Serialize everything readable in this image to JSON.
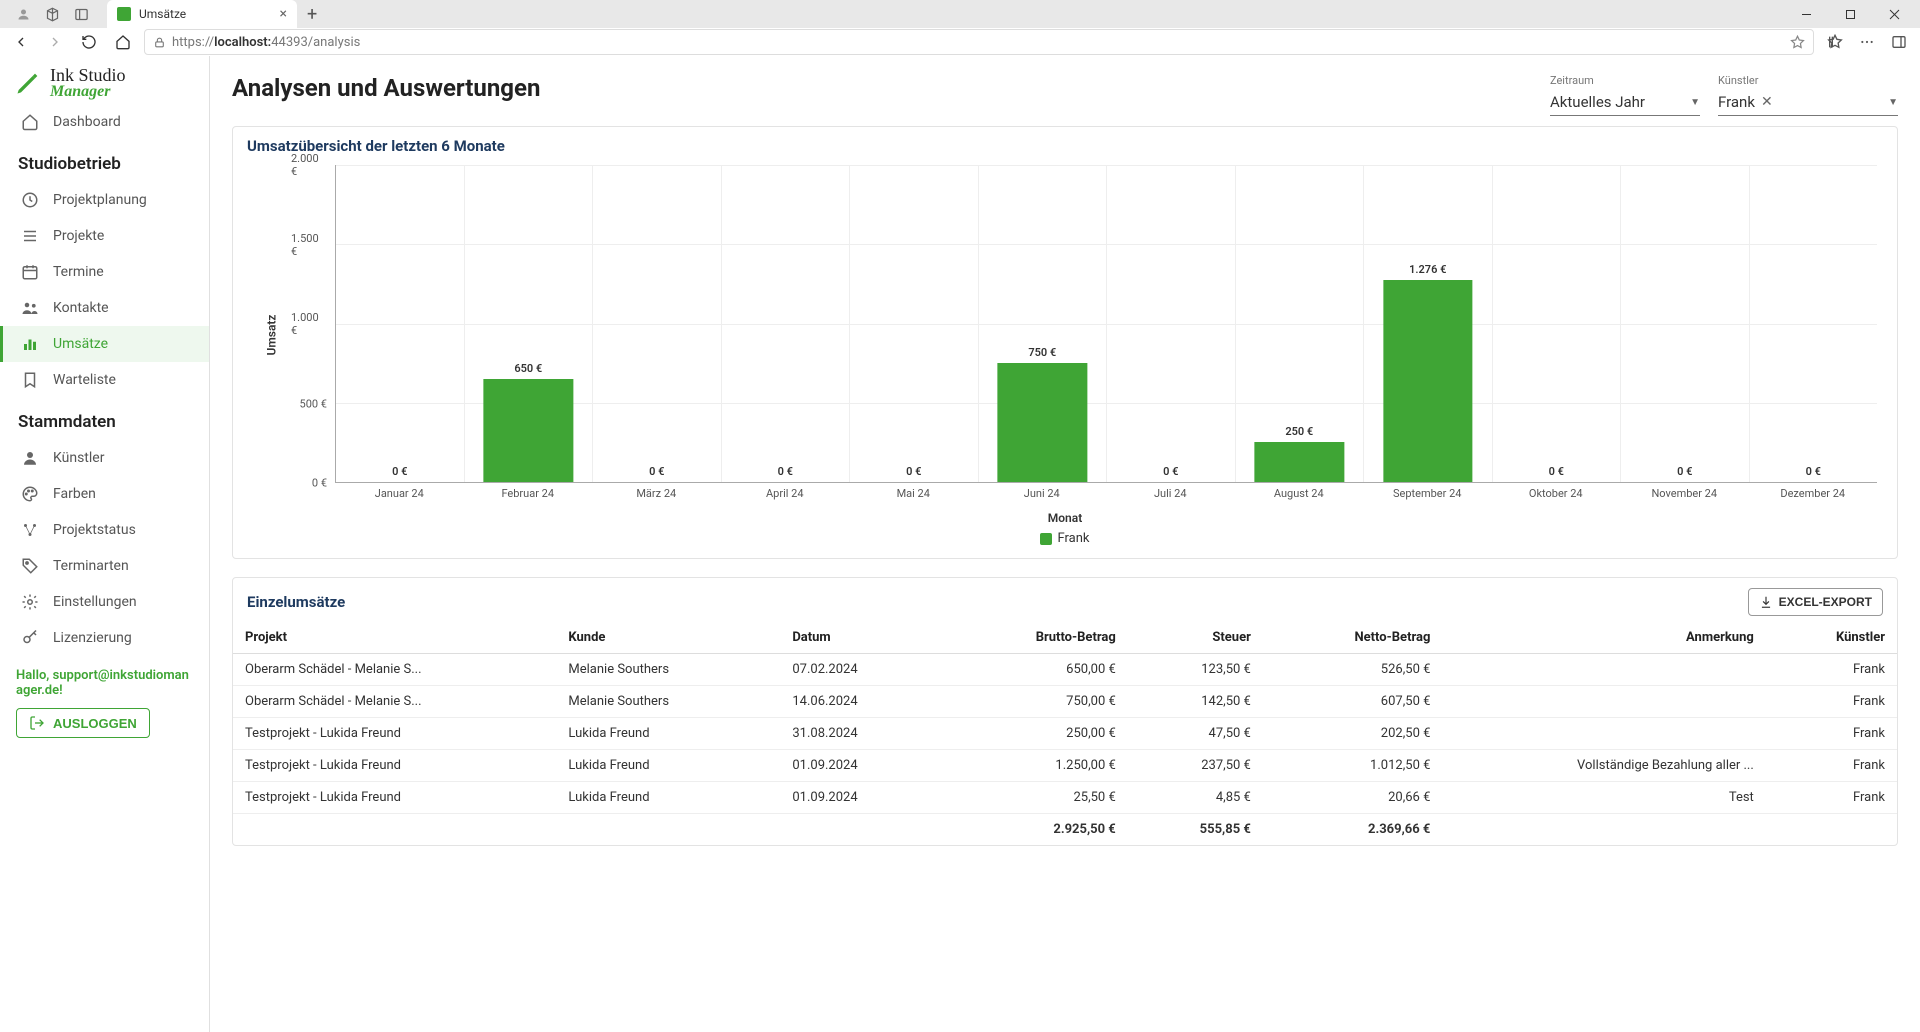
{
  "browser": {
    "tab_title": "Umsätze",
    "url_prefix": "https://",
    "url_bold": "localhost:",
    "url_rest": "44393/analysis"
  },
  "logo": {
    "line1": "Ink Studio",
    "line2": "Manager"
  },
  "sidebar": {
    "plain": [
      {
        "label": "Dashboard"
      }
    ],
    "group1_title": "Studiobetrieb",
    "group1": [
      {
        "label": "Projektplanung"
      },
      {
        "label": "Projekte"
      },
      {
        "label": "Termine"
      },
      {
        "label": "Kontakte"
      },
      {
        "label": "Umsätze",
        "active": true
      },
      {
        "label": "Warteliste"
      }
    ],
    "group2_title": "Stammdaten",
    "group2": [
      {
        "label": "Künstler"
      },
      {
        "label": "Farben"
      },
      {
        "label": "Projektstatus"
      },
      {
        "label": "Terminarten"
      },
      {
        "label": "Einstellungen"
      },
      {
        "label": "Lizenzierung"
      }
    ],
    "greeting": "Hallo, support@inkstudiomanager.de!",
    "logout": "AUSLOGGEN"
  },
  "page": {
    "title": "Analysen und Auswertungen",
    "filters": {
      "zeitraum": {
        "label": "Zeitraum",
        "value": "Aktuelles Jahr"
      },
      "kuenstler": {
        "label": "Künstler",
        "value": "Frank"
      }
    }
  },
  "chart_card": {
    "title": "Umsatzübersicht der letzten 6 Monate"
  },
  "chart_data": {
    "type": "bar",
    "title": "Umsatzübersicht der letzten 6 Monate",
    "xlabel": "Monat",
    "ylabel": "Umsatz",
    "ylim": [
      0,
      2000
    ],
    "yticks": [
      0,
      500,
      1000,
      1500,
      2000
    ],
    "ytick_labels": [
      "0 €",
      "500 €",
      "1.000 €",
      "1.500 €",
      "2.000 €"
    ],
    "categories": [
      "Januar 24",
      "Februar 24",
      "März 24",
      "April 24",
      "Mai 24",
      "Juni 24",
      "Juli 24",
      "August 24",
      "September 24",
      "Oktober 24",
      "November 24",
      "Dezember 24"
    ],
    "series": [
      {
        "name": "Frank",
        "color": "#3fa535",
        "values": [
          0,
          650,
          0,
          0,
          0,
          750,
          0,
          250,
          1276,
          0,
          0,
          0
        ],
        "value_labels": [
          "0 €",
          "650 €",
          "0 €",
          "0 €",
          "0 €",
          "750 €",
          "0 €",
          "250 €",
          "1.276 €",
          "0 €",
          "0 €",
          "0 €"
        ]
      }
    ]
  },
  "table_card": {
    "title": "Einzelumsätze",
    "export_label": "EXCEL-EXPORT"
  },
  "table": {
    "columns": [
      "Projekt",
      "Kunde",
      "Datum",
      "Brutto-Betrag",
      "Steuer",
      "Netto-Betrag",
      "Anmerkung",
      "Künstler"
    ],
    "col_align": [
      "l",
      "l",
      "l",
      "r",
      "r",
      "r",
      "r",
      "r"
    ],
    "rows": [
      {
        "cells": [
          "Oberarm Schädel - Melanie S...",
          "Melanie Southers",
          "07.02.2024",
          "650,00 €",
          "123,50 €",
          "526,50 €",
          "",
          "Frank"
        ]
      },
      {
        "cells": [
          "Oberarm Schädel - Melanie S...",
          "Melanie Southers",
          "14.06.2024",
          "750,00 €",
          "142,50 €",
          "607,50 €",
          "",
          "Frank"
        ]
      },
      {
        "cells": [
          "Testprojekt - Lukida Freund",
          "Lukida Freund",
          "31.08.2024",
          "250,00 €",
          "47,50 €",
          "202,50 €",
          "",
          "Frank"
        ]
      },
      {
        "cells": [
          "Testprojekt - Lukida Freund",
          "Lukida Freund",
          "01.09.2024",
          "1.250,00 €",
          "237,50 €",
          "1.012,50 €",
          "Vollständige Bezahlung aller ...",
          "Frank"
        ]
      },
      {
        "cells": [
          "Testprojekt - Lukida Freund",
          "Lukida Freund",
          "01.09.2024",
          "25,50 €",
          "4,85 €",
          "20,66 €",
          "Test",
          "Frank"
        ]
      }
    ],
    "footer": [
      "",
      "",
      "",
      "2.925,50 €",
      "555,85 €",
      "2.369,66 €",
      "",
      ""
    ]
  },
  "colors": {
    "brand": "#3fa535"
  }
}
